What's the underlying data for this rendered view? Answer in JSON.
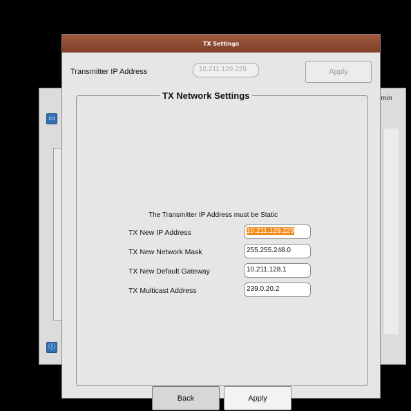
{
  "background_window": {
    "admin_label": "dmin"
  },
  "dialog": {
    "title": "TX Settings",
    "transmitter_ip_label": "Transmitter IP Address",
    "transmitter_ip_value": "10.211.129.229",
    "apply_top_label": "Apply",
    "network_group_title": "TX Network Settings",
    "static_note": "The Transmitter IP Address must be Static",
    "rows": [
      {
        "label": "TX New IP Address",
        "value": "10.211.129.229",
        "selected": true
      },
      {
        "label": "TX New Network Mask",
        "value": "255.255.248.0"
      },
      {
        "label": "TX New Default Gateway",
        "value": "10.211.128.1"
      },
      {
        "label": "TX Multicast Address",
        "value": "239.0.20.2"
      }
    ],
    "back_label": "Back",
    "apply_label": "Apply"
  },
  "colors": {
    "titlebar": "#8e4a32",
    "selection": "#f28a1a",
    "dialog_bg": "#e6e6e6"
  }
}
